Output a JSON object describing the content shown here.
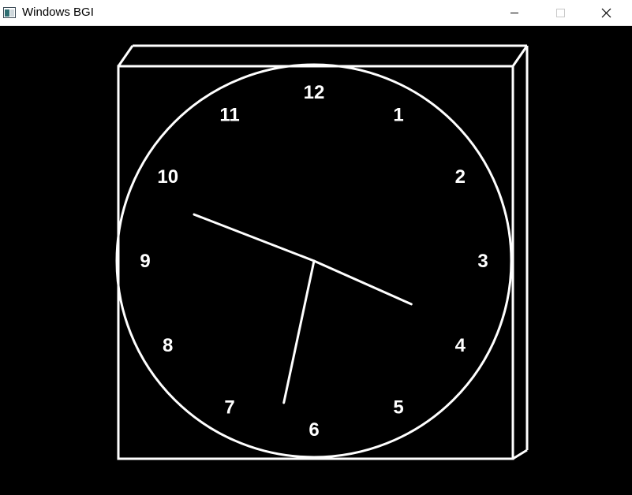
{
  "window": {
    "title": "Windows BGI",
    "buttons": {
      "minimize": "minimize-icon",
      "maximize": "maximize-icon",
      "close": "close-icon"
    }
  },
  "colors": {
    "background": "#000000",
    "drawing": "#ffffff",
    "titlebar": "#ffffff"
  },
  "clock": {
    "numerals": [
      "12",
      "1",
      "2",
      "3",
      "4",
      "5",
      "6",
      "7",
      "8",
      "9",
      "10",
      "11"
    ],
    "time": {
      "hour": 3,
      "minute": 48,
      "second": 32
    }
  }
}
